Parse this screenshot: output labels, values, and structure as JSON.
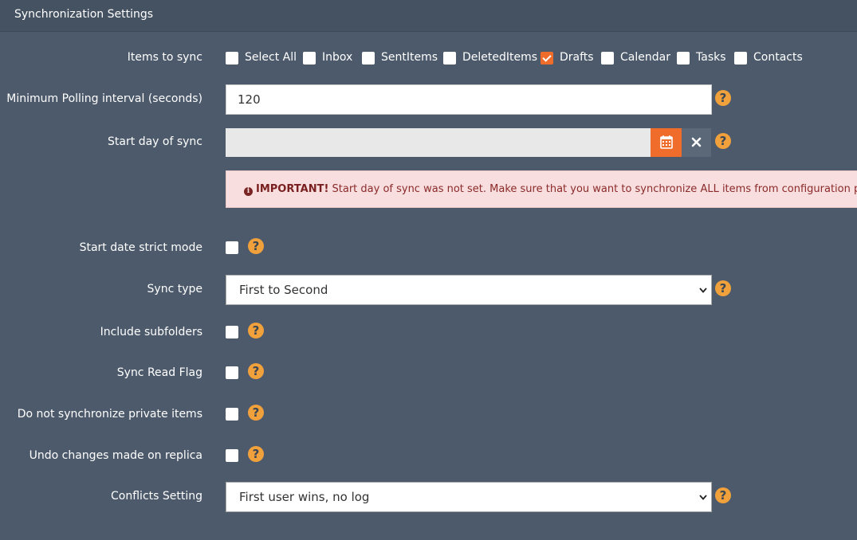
{
  "header": {
    "title": "Synchronization Settings"
  },
  "items_to_sync": {
    "label": "Items to sync",
    "options": [
      {
        "label": "Select All",
        "checked": false
      },
      {
        "label": "Inbox",
        "checked": false
      },
      {
        "label": "SentItems",
        "checked": false
      },
      {
        "label": "DeletedItems",
        "checked": false
      },
      {
        "label": "Drafts",
        "checked": true
      },
      {
        "label": "Calendar",
        "checked": false
      },
      {
        "label": "Tasks",
        "checked": false
      },
      {
        "label": "Contacts",
        "checked": false
      }
    ]
  },
  "polling": {
    "label": "Minimum Polling interval (seconds)",
    "value": "120"
  },
  "start_day": {
    "label": "Start day of sync",
    "value": ""
  },
  "alert": {
    "strong": "IMPORTANT!",
    "text": " Start day of sync was not set. Make sure that you want to synchronize ALL items from configuration pair."
  },
  "strict_mode": {
    "label": "Start date strict mode",
    "checked": false
  },
  "sync_type": {
    "label": "Sync type",
    "selected": "First to Second"
  },
  "include_subfolders": {
    "label": "Include subfolders",
    "checked": false
  },
  "sync_read_flag": {
    "label": "Sync Read Flag",
    "checked": false
  },
  "private_items": {
    "label": "Do not synchronize private items",
    "checked": false
  },
  "undo_changes": {
    "label": "Undo changes made on replica",
    "checked": false
  },
  "conflicts": {
    "label": "Conflicts Setting",
    "selected": "First user wins, no log"
  },
  "icons": {
    "help": "question-circle-icon",
    "calendar": "calendar-icon",
    "clear": "close-icon",
    "alert": "info-circle-icon"
  },
  "colors": {
    "background": "#4c5a6b",
    "accent": "#ef6c2b",
    "help": "#f0a13c",
    "alert_bg": "#f8dede",
    "alert_text": "#8b2a2a"
  }
}
